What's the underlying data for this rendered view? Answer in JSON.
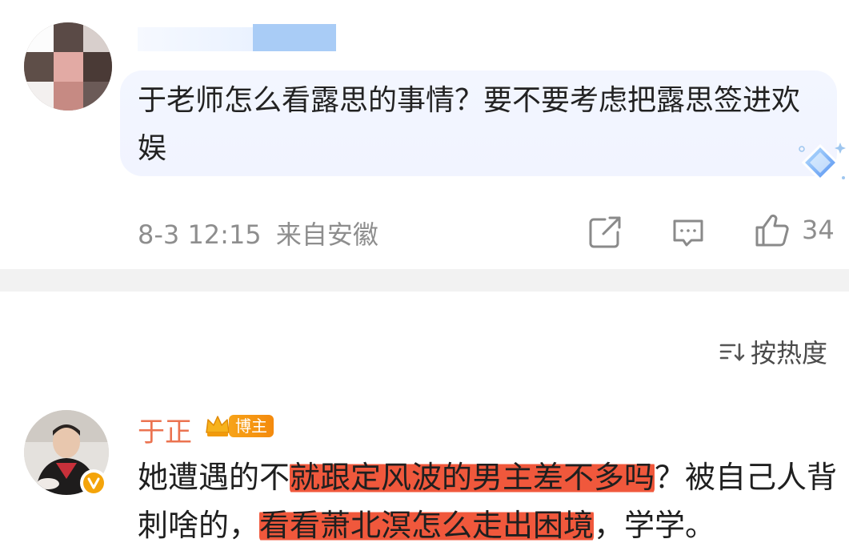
{
  "comment1": {
    "text": "于老师怎么看露思的事情？要不要考虑把露思签进欢娱",
    "timestamp": "8-3 12:15",
    "location": "来自安徽",
    "like_count": "34",
    "icons": [
      "share-icon",
      "comment-icon",
      "like-icon",
      "diamond-badge-icon"
    ]
  },
  "sort": {
    "label": "按热度",
    "icon": "sort-icon"
  },
  "comment2": {
    "author": "于正",
    "badge_label": "博主",
    "text_before": "她遭遇的不",
    "highlight1": "就跟定风波的男主差不多吗",
    "text_middle": "？被自己人背刺啥的，",
    "highlight2": "看看萧北溟怎么走出困境",
    "text_after": "，学学。",
    "verified_icon": "verified-v-icon",
    "highlight_color": "#f0583c"
  },
  "colors": {
    "author_name": "#eb7350",
    "meta_text": "#8e8e8e",
    "bubble_bg": "#f2f5ff",
    "separator": "#f2f2f2"
  }
}
